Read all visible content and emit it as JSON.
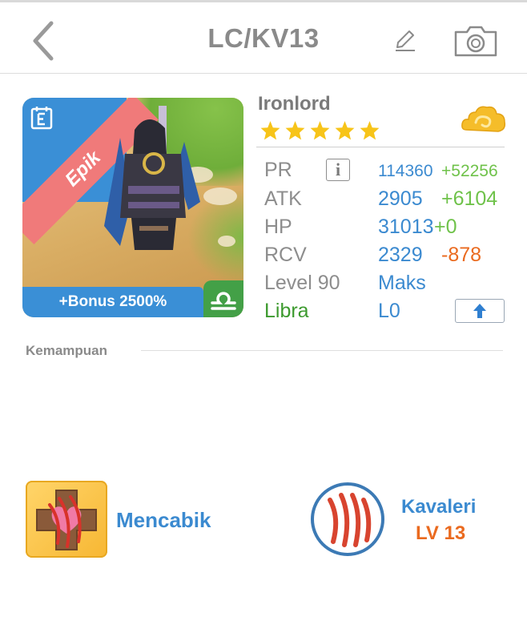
{
  "header": {
    "title": "LC/KV13",
    "back_icon": "chevron-left-icon",
    "edit_icon": "pencil-icon",
    "camera_icon": "camera-icon"
  },
  "card": {
    "rarity_label": "Epik",
    "bonus_label": "+Bonus 2500%",
    "corner_icon": "calendar-e-icon",
    "zodiac_icon": "libra-icon",
    "colors": {
      "rarity_ribbon": "#f07a7a",
      "frame": "#3a8fd6",
      "zodiac_badge": "#43a047"
    }
  },
  "unit": {
    "name": "Ironlord",
    "stars": 5,
    "element_icon": "cloud-icon"
  },
  "stats": {
    "pr": {
      "label": "PR",
      "value": "114360",
      "bonus": "+52256"
    },
    "atk": {
      "label": "ATK",
      "value": "2905",
      "bonus": "+6104"
    },
    "hp": {
      "label": "HP",
      "value": "31013",
      "bonus": "+0"
    },
    "rcv": {
      "label": "RCV",
      "value": "2329",
      "bonus": "-878"
    },
    "level": {
      "label": "Level 90",
      "value": "Maks"
    },
    "sign": {
      "label": "Libra",
      "value": "L0"
    },
    "info_icon": "info-icon",
    "upgrade_icon": "arrow-up-icon"
  },
  "abilities": {
    "section_title": "Kemampuan",
    "skill_1": {
      "name": "Mencabik",
      "icon": "claw-heart-cross-icon"
    },
    "skill_2": {
      "name": "Kavaleri",
      "level": "LV 13",
      "icon": "claw-marks-icon"
    }
  }
}
